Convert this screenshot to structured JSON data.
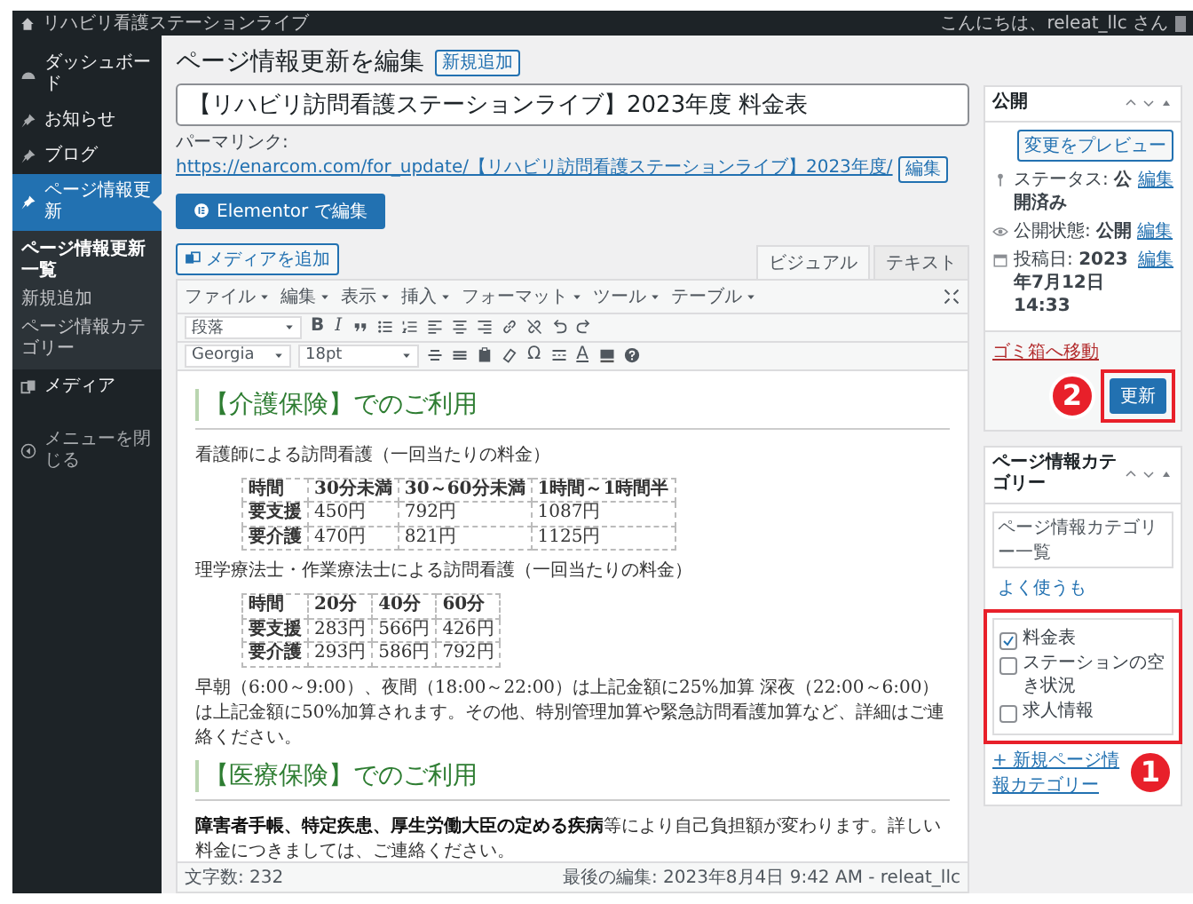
{
  "admin_bar": {
    "site_name": "リハビリ看護ステーションライブ",
    "greeting": "こんにちは、releat_llc さん"
  },
  "sidebar": {
    "items": [
      {
        "label": "ダッシュボード",
        "kind": "dashboard",
        "selected": false
      },
      {
        "label": "お知らせ",
        "kind": "post_type",
        "selected": false
      },
      {
        "label": "ブログ",
        "kind": "post_type",
        "selected": false
      },
      {
        "label": "ページ情報更新",
        "kind": "post_type",
        "selected": true,
        "children": [
          {
            "label": "ページ情報更新一覧",
            "selected": true
          },
          {
            "label": "新規追加",
            "selected": false
          },
          {
            "label": "ページ情報カテゴリー",
            "selected": false
          }
        ]
      },
      {
        "label": "メディア",
        "kind": "media",
        "selected": false
      }
    ],
    "collapse": "メニューを閉じる"
  },
  "page": {
    "heading": "ページ情報更新を編集",
    "add_new": "新規追加",
    "title_value": "【リハビリ訪問看護ステーションライブ】2023年度 料金表",
    "permalink_label": "パーマリンク:",
    "permalink_url": "https://enarcom.com/for_update/",
    "permalink_slug": "【リハビリ訪問看護ステーションライブ】2023年度/",
    "permalink_edit": "編集",
    "elementor_button": "Elementor で編集",
    "add_media": "メディアを追加"
  },
  "editor": {
    "tabs": [
      {
        "label": "ビジュアル",
        "selected": true
      },
      {
        "label": "テキスト",
        "selected": false
      }
    ],
    "menu": [
      "ファイル",
      "編集",
      "表示",
      "挿入",
      "フォーマット",
      "ツール",
      "テーブル"
    ],
    "toolbar": {
      "block_format": "段落",
      "bold": "B",
      "italic": "I",
      "font": "Georgia",
      "size": "18pt",
      "special_char": "Ω",
      "text_color": "A"
    },
    "content": [
      {
        "kind": "heading",
        "text": "【介護保険】でのご利用"
      },
      {
        "kind": "rule"
      },
      {
        "kind": "paragraph",
        "text": "看護師による訪問看護（一回当たりの料金）"
      },
      {
        "kind": "table",
        "rows": [
          [
            "時間",
            "30分未満",
            "30～60分未満",
            "1時間～1時間半"
          ],
          [
            "要支援",
            "450円",
            "792円",
            "1087円"
          ],
          [
            "要介護",
            "470円",
            "821円",
            "1125円"
          ]
        ]
      },
      {
        "kind": "paragraph",
        "text": "理学療法士・作業療法士による訪問看護（一回当たりの料金）"
      },
      {
        "kind": "table",
        "rows": [
          [
            "時間",
            "20分",
            "40分",
            "60分"
          ],
          [
            "要支援",
            "283円",
            "566円",
            "426円"
          ],
          [
            "要介護",
            "293円",
            "586円",
            "792円"
          ]
        ]
      },
      {
        "kind": "paragraph",
        "text": "早朝（6:00～9:00）、夜間（18:00～22:00）は上記金額に25%加算 深夜（22:00～6:00）は上記金額に50%加算されます。その他、特別管理加算や緊急訪問看護加算など、詳細はご連絡ください。"
      },
      {
        "kind": "heading",
        "text": "【医療保険】でのご利用"
      },
      {
        "kind": "rule"
      },
      {
        "kind": "paragraph",
        "text": "**障害者手帳、特定疾患、厚生労働大臣の定める疾病**等により自己負担額が変わります。詳しい料金につきましては、ご連絡ください。"
      }
    ],
    "word_count": "文字数: 232",
    "last_edited": "最後の編集: 2023年8月4日 9:42 AM - releat_llc"
  },
  "publish": {
    "title": "公開",
    "preview": "変更をプレビュー",
    "meta": [
      {
        "kind": "status",
        "label": "ステータス:",
        "value": "公開済み",
        "link": "編集"
      },
      {
        "kind": "visibility",
        "label": "公開状態:",
        "value": "公開",
        "link": "編集"
      },
      {
        "kind": "date",
        "label": "投稿日:",
        "value": "2023年7月12日 14:33",
        "link": "編集"
      }
    ],
    "trash": "ゴミ箱へ移動",
    "update": "更新",
    "callout": "2"
  },
  "categories": {
    "title": "ページ情報カテゴリー",
    "tabs": [
      {
        "label": "ページ情報カテゴリー一覧",
        "selected": true
      },
      {
        "label": "よく使うも",
        "selected": false
      }
    ],
    "items": [
      {
        "label": "料金表",
        "checked": true
      },
      {
        "label": "ステーションの空き状況",
        "checked": false
      },
      {
        "label": "求人情報",
        "checked": false
      }
    ],
    "add_link": "+ 新規ページ情報カテゴリー",
    "callout": "1"
  }
}
